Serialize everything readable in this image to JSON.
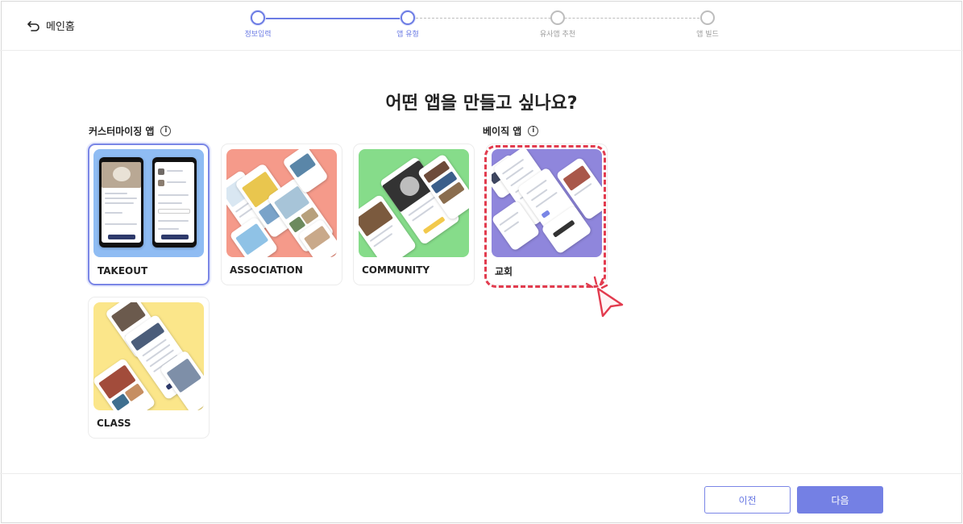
{
  "header": {
    "home_label": "메인홈",
    "steps": [
      {
        "label": "정보입력",
        "state": "done"
      },
      {
        "label": "앱 유형",
        "state": "current"
      },
      {
        "label": "유사앱 추천",
        "state": "todo"
      },
      {
        "label": "앱 빌드",
        "state": "todo"
      }
    ]
  },
  "main": {
    "title": "어떤 앱을 만들고 싶나요?",
    "sections": {
      "custom": {
        "label": "커스터마이징 앱",
        "info_icon": "info-circle-icon"
      },
      "basic": {
        "label": "베이직 앱",
        "info_icon": "info-circle-icon"
      }
    },
    "cards": [
      {
        "label": "TAKEOUT",
        "bg": "#8fbcf3",
        "selected": true
      },
      {
        "label": "ASSOCIATION",
        "bg": "#f59a8a",
        "selected": false
      },
      {
        "label": "COMMUNITY",
        "bg": "#86dc8a",
        "selected": false
      },
      {
        "label": "교회",
        "bg": "#8f86dc",
        "selected": false
      },
      {
        "label": "CLASS",
        "bg": "#fbe68a",
        "selected": false
      }
    ]
  },
  "footer": {
    "prev_label": "이전",
    "next_label": "다음"
  },
  "colors": {
    "accent": "#7480e4",
    "highlight": "#e23b4e"
  }
}
